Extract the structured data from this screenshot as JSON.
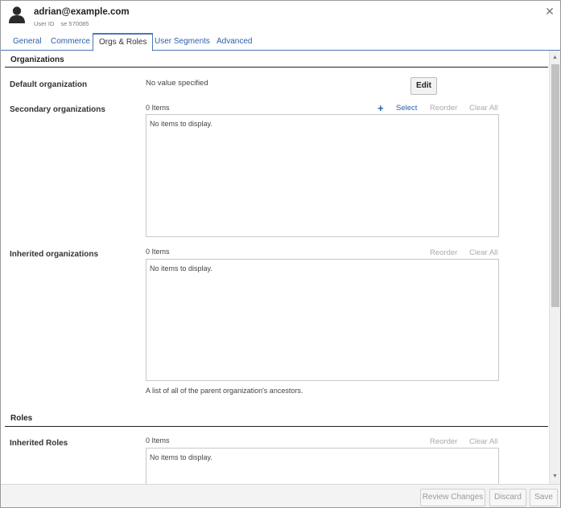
{
  "header": {
    "user_email": "adrian@example.com",
    "user_id_label": "User ID",
    "user_id_value": "se 570085",
    "close_glyph": "✕"
  },
  "tabs": [
    {
      "label": "General"
    },
    {
      "label": "Commerce"
    },
    {
      "label": "Orgs & Roles",
      "active": true
    },
    {
      "label": "User Segments"
    },
    {
      "label": "Advanced"
    }
  ],
  "organizations": {
    "title": "Organizations",
    "default_org": {
      "label": "Default organization",
      "value": "No value specified",
      "edit_label": "Edit"
    },
    "secondary_orgs": {
      "label": "Secondary organizations",
      "count": "0 Items",
      "select_label": "Select",
      "reorder_label": "Reorder",
      "clear_label": "Clear All",
      "empty_text": "No items to display."
    },
    "inherited_orgs": {
      "label": "Inherited organizations",
      "count": "0 Items",
      "reorder_label": "Reorder",
      "clear_label": "Clear All",
      "empty_text": "No items to display.",
      "note": "A list of all of the parent organization's ancestors."
    }
  },
  "roles": {
    "title": "Roles",
    "inherited_roles": {
      "label": "Inherited Roles",
      "count": "0 Items",
      "reorder_label": "Reorder",
      "clear_label": "Clear All",
      "empty_text": "No items to display."
    }
  },
  "footer": {
    "review_label": "Review Changes",
    "discard_label": "Discard",
    "save_label": "Save"
  },
  "colors": {
    "link": "#2d5ea6",
    "disabled": "#aaaaaa",
    "tab_border": "#4a78b4"
  },
  "icons": {
    "avatar": "user-silhouette-icon",
    "close": "close-icon",
    "add": "plus-icon",
    "scroll_up": "triangle-up-icon",
    "scroll_down": "triangle-down-icon"
  }
}
